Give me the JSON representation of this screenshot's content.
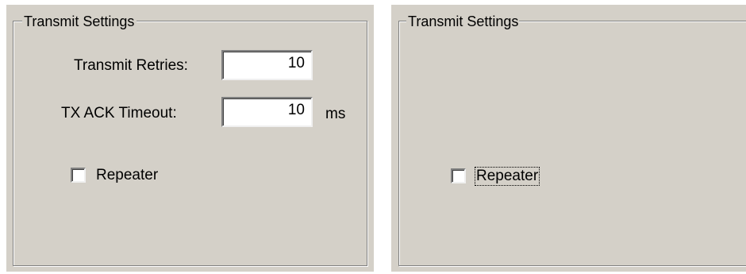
{
  "left_panel": {
    "group_title": "Transmit Settings",
    "transmit_retries": {
      "label": "Transmit Retries:",
      "value": "10"
    },
    "tx_ack_timeout": {
      "label": "TX ACK Timeout:",
      "value": "10",
      "unit": "ms"
    },
    "repeater": {
      "label": "Repeater",
      "checked": false
    }
  },
  "right_panel": {
    "group_title": "Transmit Settings",
    "repeater": {
      "label": "Repeater",
      "checked": false,
      "focused": true
    }
  },
  "colors": {
    "dialog_background": "#d4d0c8",
    "field_background": "#ffffff",
    "shadow": "#808080"
  }
}
